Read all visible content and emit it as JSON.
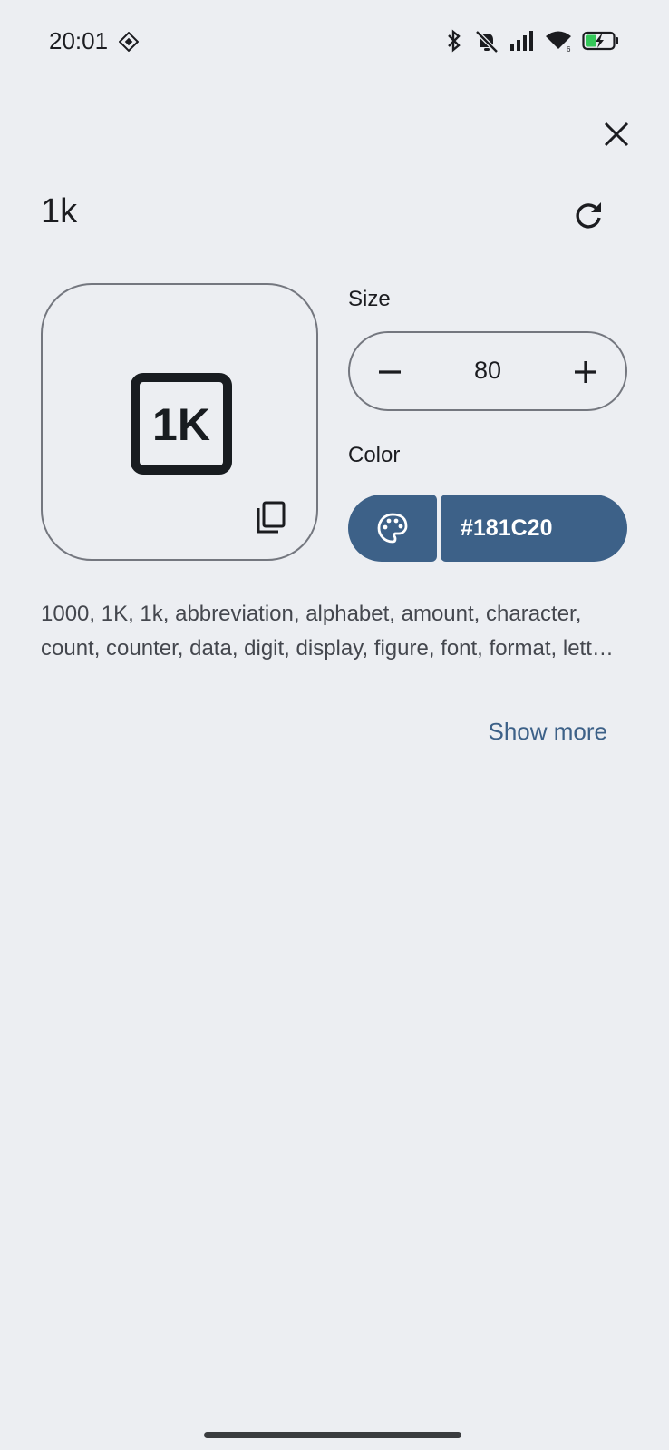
{
  "status_bar": {
    "time": "20:01",
    "icons": [
      "location-diamond-icon",
      "bluetooth-icon",
      "mute-icon",
      "signal-icon",
      "wifi-icon",
      "battery-charging-icon"
    ]
  },
  "header": {
    "title": "1k",
    "close_icon": "close-icon",
    "reset_icon": "refresh-icon"
  },
  "preview": {
    "glyph": "1K",
    "copy_icon": "copy-icon"
  },
  "size": {
    "label": "Size",
    "value": "80"
  },
  "color": {
    "label": "Color",
    "hex": "#181C20",
    "button_color": "#3d6188"
  },
  "tags": "1000, 1K, 1k, abbreviation, alphabet, amount, character, count, counter, data, digit, display, figure, font, format, letter, measure, number, numeral, one thousand, size, symbol, text, thousand, type",
  "show_more": "Show more"
}
